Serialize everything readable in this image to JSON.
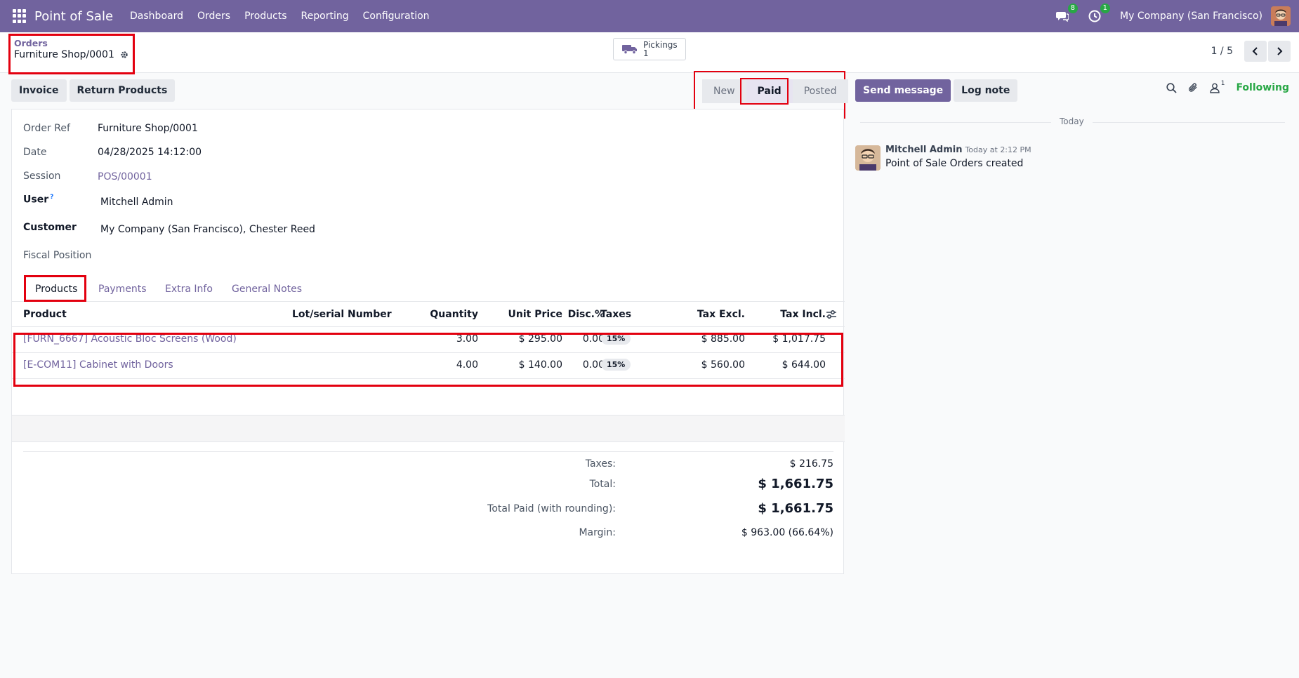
{
  "navbar": {
    "app_name": "Point of Sale",
    "menu": [
      "Dashboard",
      "Orders",
      "Products",
      "Reporting",
      "Configuration"
    ],
    "messages_badge": "8",
    "activity_badge": "1",
    "company": "My Company (San Francisco)"
  },
  "control": {
    "breadcrumb_parent": "Orders",
    "record_title": "Furniture Shop/0001",
    "pickings_label": "Pickings",
    "pickings_count": "1",
    "pager": "1 / 5"
  },
  "actions": {
    "invoice": "Invoice",
    "return_products": "Return Products"
  },
  "status": {
    "steps": [
      "New",
      "Paid",
      "Posted"
    ],
    "active": "Paid"
  },
  "form": {
    "order_ref_label": "Order Ref",
    "order_ref": "Furniture Shop/0001",
    "date_label": "Date",
    "date": "04/28/2025 14:12:00",
    "session_label": "Session",
    "session": "POS/00001",
    "user_label": "User",
    "user_tip": "?",
    "user": "Mitchell Admin",
    "customer_label": "Customer",
    "customer": "My Company (San Francisco), Chester Reed",
    "fiscal_label": "Fiscal Position"
  },
  "tabs": [
    "Products",
    "Payments",
    "Extra Info",
    "General Notes"
  ],
  "table": {
    "headers": [
      "Product",
      "Lot/serial Number",
      "Quantity",
      "Unit Price",
      "Disc.%",
      "Taxes",
      "Tax Excl.",
      "Tax Incl."
    ],
    "rows": [
      {
        "product": "[FURN_6667] Acoustic Bloc Screens (Wood)",
        "qty": "3.00",
        "price": "$ 295.00",
        "disc": "0.00",
        "tax": "15%",
        "excl": "$ 885.00",
        "incl": "$ 1,017.75"
      },
      {
        "product": "[E-COM11] Cabinet with Doors",
        "qty": "4.00",
        "price": "$ 140.00",
        "disc": "0.00",
        "tax": "15%",
        "excl": "$ 560.00",
        "incl": "$ 644.00"
      }
    ]
  },
  "totals": {
    "taxes_label": "Taxes:",
    "taxes": "$ 216.75",
    "total_label": "Total:",
    "total": "$ 1,661.75",
    "paid_label": "Total Paid (with rounding):",
    "paid": "$ 1,661.75",
    "margin_label": "Margin:",
    "margin": "$ 963.00 (66.64%)"
  },
  "chatter": {
    "send_message": "Send message",
    "log_note": "Log note",
    "followers_count": "1",
    "following": "Following",
    "date_separator": "Today",
    "message": {
      "author": "Mitchell Admin",
      "time": "Today at 2:12 PM",
      "body": "Point of Sale Orders created"
    }
  },
  "colors": {
    "navbar": "#71639e",
    "accent": "#71639e",
    "highlight": "#e3000f",
    "following": "#28a745"
  }
}
